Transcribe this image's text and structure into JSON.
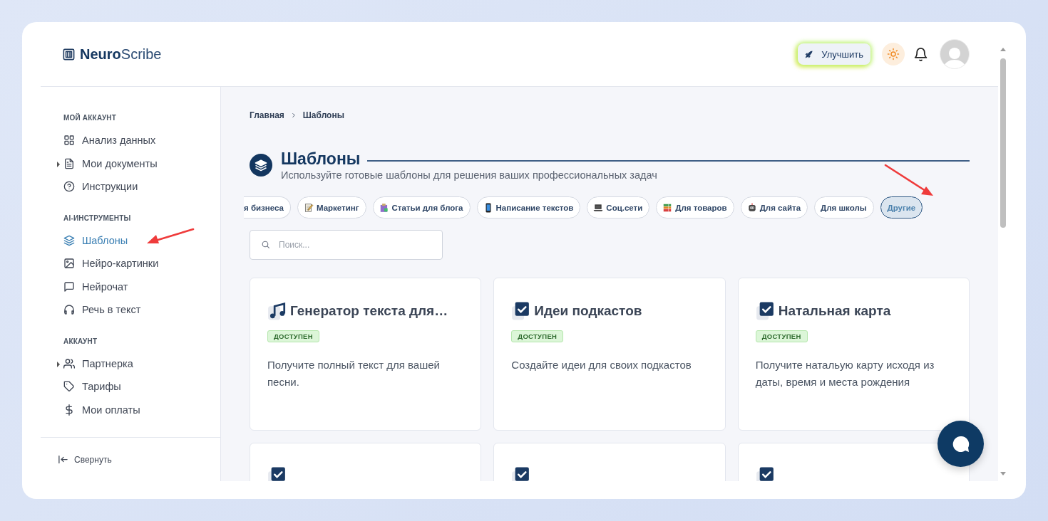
{
  "header": {
    "logo": "**Neuro**Scribe",
    "upgrade_button": "Улучшить"
  },
  "sidebar": {
    "sections": [
      {
        "title": "МОЙ АККАУНТ",
        "items": [
          {
            "label": "Анализ данных",
            "selected": false,
            "expandable": false
          },
          {
            "label": "Мои документы",
            "selected": false,
            "expandable": true
          },
          {
            "label": "Инструкции",
            "selected": false,
            "expandable": false
          }
        ]
      },
      {
        "title": "AI-ИНСТРУМЕНТЫ",
        "items": [
          {
            "label": "Шаблоны",
            "selected": true,
            "expandable": false
          },
          {
            "label": "Нейро-картинки",
            "selected": false,
            "expandable": false
          },
          {
            "label": "Нейрочат",
            "selected": false,
            "expandable": false
          },
          {
            "label": "Речь в текст",
            "selected": false,
            "expandable": false
          }
        ]
      },
      {
        "title": "АККАУНТ",
        "items": [
          {
            "label": "Партнерка",
            "selected": false,
            "expandable": true
          },
          {
            "label": "Тарифы",
            "selected": false,
            "expandable": false
          },
          {
            "label": "Мои оплаты",
            "selected": false,
            "expandable": false
          }
        ]
      }
    ],
    "collapse_button": "Свернуть"
  },
  "main": {
    "breadcrumbs": [
      "Главная",
      "Шаблоны"
    ],
    "title": "Шаблоны",
    "subtitle": "Используйте готовые шаблоны для решения ваших профессиональных задач",
    "categories": [
      {
        "label": "я бизнеса",
        "selected": false
      },
      {
        "label": "Маркетинг",
        "selected": false
      },
      {
        "label": "Статьи для блога",
        "selected": false
      },
      {
        "label": "Написание текстов",
        "selected": false
      },
      {
        "label": "Соц.сети",
        "selected": false
      },
      {
        "label": "Для товаров",
        "selected": false
      },
      {
        "label": "Для сайта",
        "selected": false
      },
      {
        "label": "Для школы",
        "selected": false
      },
      {
        "label": "Другие",
        "selected": true
      }
    ],
    "search": {
      "placeholder": "Поиск..."
    },
    "templates": [
      {
        "kind": "music",
        "title": "Генератор текста для…",
        "badge": "ДОСТУПЕН",
        "description": "Получите полный текст для вашей песни."
      },
      {
        "kind": "check",
        "title": "Идеи подкастов",
        "badge": "ДОСТУПЕН",
        "description": "Создайте идеи для своих подкастов"
      },
      {
        "kind": "check",
        "title": "Натальная карта",
        "badge": "ДОСТУПЕН",
        "description": "Получите натальую карту исходя из даты, время и места рождения"
      },
      {
        "kind": "check"
      },
      {
        "kind": "check"
      },
      {
        "kind": "check"
      }
    ]
  }
}
